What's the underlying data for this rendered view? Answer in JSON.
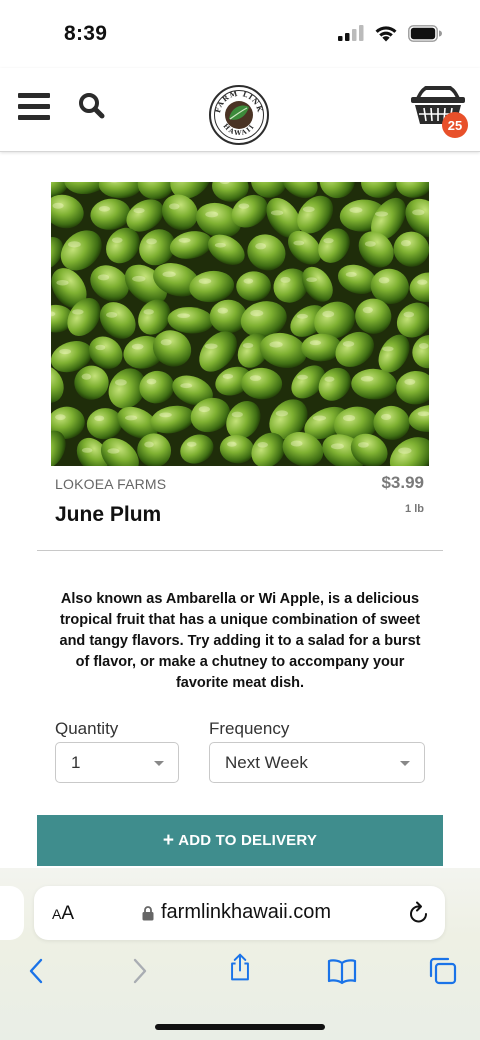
{
  "status_bar": {
    "time": "8:39"
  },
  "header": {
    "logo_text": "FARM LINK HAWAII",
    "cart_count": "25"
  },
  "product": {
    "brand": "LOKOEA FARMS",
    "price": "$3.99",
    "name": "June Plum",
    "unit": "1 lb",
    "description": "Also known as Ambarella or Wi Apple, is a delicious tropical fruit that has a unique combination of sweet and tangy flavors. Try adding it to a salad for a burst of flavor, or make a chutney to accompany your favorite meat dish."
  },
  "quantity": {
    "label": "Quantity",
    "value": "1"
  },
  "frequency": {
    "label": "Frequency",
    "value": "Next Week"
  },
  "add_button": {
    "label": "ADD TO DELIVERY"
  },
  "browser": {
    "aa_label_small": "A",
    "aa_label_large": "A",
    "url": "farmlinkhawaii.com"
  },
  "colors": {
    "accent": "#3f8d8d",
    "badge": "#e8502a",
    "logo_green": "#3c8a3a",
    "ios_blue": "#1a73e8"
  },
  "icons": {
    "menu": "hamburger-icon",
    "search": "search-icon",
    "cart": "basket-icon",
    "back": "chevron-left-icon",
    "forward": "chevron-right-icon",
    "share": "share-icon",
    "bookmarks": "book-icon",
    "tabs": "tabs-icon",
    "lock": "lock-icon",
    "reload": "reload-icon"
  }
}
